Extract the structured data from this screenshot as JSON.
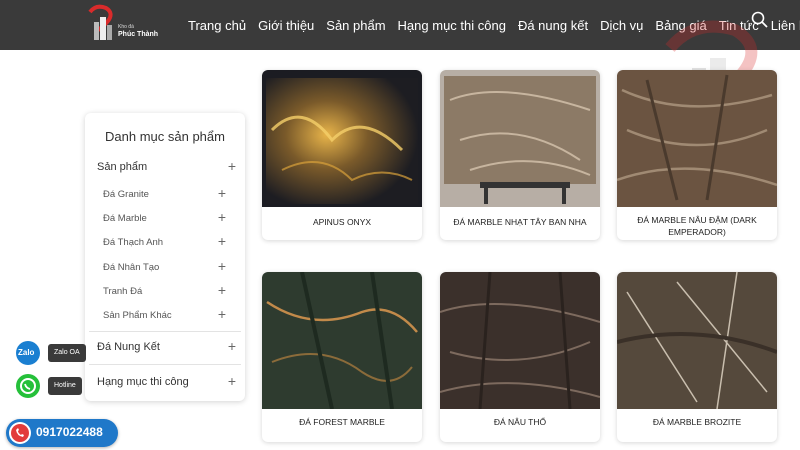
{
  "brand": {
    "small": "Kho đá",
    "name": "Phúc Thành"
  },
  "nav": [
    {
      "label": "Trang chủ"
    },
    {
      "label": "Giới thiệu"
    },
    {
      "label": "Sản phẩm"
    },
    {
      "label": "Hạng mục thi công"
    },
    {
      "label": "Đá nung kết"
    },
    {
      "label": "Dịch vụ"
    },
    {
      "label": "Bảng giá"
    },
    {
      "label": "Tin tức"
    },
    {
      "label": "Liên hệ"
    }
  ],
  "sidebar": {
    "title": "Danh mục sản phẩm",
    "section_products": "Sản phẩm",
    "subitems": [
      {
        "label": "Đá Granite"
      },
      {
        "label": "Đá Marble"
      },
      {
        "label": "Đá Thạch Anh"
      },
      {
        "label": "Đá Nhân Tạo"
      },
      {
        "label": "Tranh Đá"
      },
      {
        "label": "Sản Phẩm Khác"
      }
    ],
    "section_sintered": "Đá Nung Kết",
    "section_projects": "Hạng mục thi công"
  },
  "products": [
    {
      "name": "APINUS ONYX"
    },
    {
      "name": "ĐÁ MARBLE NHẠT TÂY BAN NHA"
    },
    {
      "name": "ĐÁ MARBLE NÂU ĐẬM (DARK EMPERADOR)"
    },
    {
      "name": "ĐÁ FOREST MARBLE"
    },
    {
      "name": "ĐÁ NÂU THỔ"
    },
    {
      "name": "ĐÁ MARBLE BROZITE"
    }
  ],
  "contact": {
    "zalo_icon": "Zalo",
    "zalo_label": "Zalo OA",
    "hotline_label": "Hotline",
    "phone": "0917022488"
  },
  "colors": {
    "header": "#3a3a3a",
    "accent": "#1f78c9",
    "brand_red": "#d92b2b"
  }
}
